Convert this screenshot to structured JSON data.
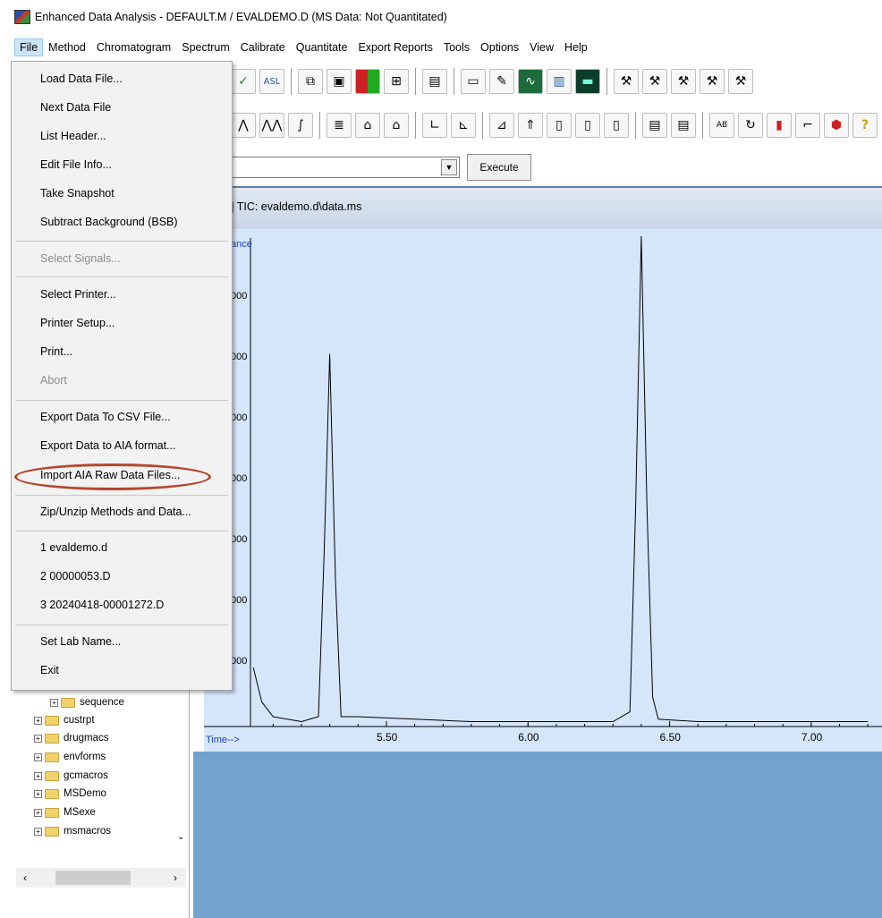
{
  "window": {
    "title": "Enhanced Data Analysis - DEFAULT.M / EVALDEMO.D    (MS Data: Not Quantitated)"
  },
  "menubar": {
    "items": [
      "File",
      "Method",
      "Chromatogram",
      "Spectrum",
      "Calibrate",
      "Quantitate",
      "Export Reports",
      "Tools",
      "Options",
      "View",
      "Help"
    ],
    "active": "File"
  },
  "file_menu": {
    "items": [
      {
        "label": "Load Data File...",
        "enabled": true
      },
      {
        "label": "Next Data File",
        "enabled": true
      },
      {
        "label": "List Header...",
        "enabled": true
      },
      {
        "label": "Edit File Info...",
        "enabled": true
      },
      {
        "label": "Take Snapshot",
        "enabled": true
      },
      {
        "label": "Subtract Background (BSB)",
        "enabled": true
      },
      {
        "label": "Select Signals...",
        "enabled": false
      },
      {
        "label": "Select Printer...",
        "enabled": true
      },
      {
        "label": "Printer Setup...",
        "enabled": true
      },
      {
        "label": "Print...",
        "enabled": true
      },
      {
        "label": "Abort",
        "enabled": false
      },
      {
        "label": "Export Data To CSV File...",
        "enabled": true
      },
      {
        "label": "Export Data to AIA format...",
        "enabled": true
      },
      {
        "label": "Import AIA Raw Data Files...",
        "enabled": true,
        "highlighted": true
      },
      {
        "label": "Zip/Unzip Methods and Data...",
        "enabled": true
      },
      {
        "label": "1  evaldemo.d",
        "enabled": true
      },
      {
        "label": "2  00000053.D",
        "enabled": true
      },
      {
        "label": "3  20240418-00001272.D",
        "enabled": true
      },
      {
        "label": "Set Lab Name...",
        "enabled": true
      },
      {
        "label": "Exit",
        "enabled": true
      }
    ],
    "highlight_color": "#b5482f"
  },
  "command": {
    "value": "",
    "execute_label": "Execute"
  },
  "chromatogram": {
    "title": "] TIC: evaldemo.d\\data.ms",
    "y_axis_partial_label": "ance",
    "x_axis_label": "Time-->",
    "x_ticks": [
      "5.50",
      "6.00",
      "6.50",
      "7.00"
    ],
    "y_tick_suffix": "000"
  },
  "chart_data": {
    "type": "line",
    "xlabel": "Time-->",
    "ylabel": "",
    "x_tick_labels": [
      "5.50",
      "6.00",
      "6.50",
      "7.00"
    ],
    "series": [
      {
        "x": [
          5.03,
          5.06,
          5.1,
          5.2,
          5.26,
          5.28,
          5.3,
          5.32,
          5.34,
          5.4,
          5.6,
          5.8,
          6.0,
          6.2,
          6.3,
          6.36,
          6.38,
          6.4,
          6.42,
          6.44,
          6.46,
          6.6,
          6.8,
          7.0,
          7.2
        ],
        "y": [
          0.12,
          0.05,
          0.02,
          0.01,
          0.02,
          0.35,
          0.76,
          0.3,
          0.02,
          0.02,
          0.015,
          0.01,
          0.01,
          0.01,
          0.01,
          0.03,
          0.45,
          1.0,
          0.45,
          0.06,
          0.015,
          0.01,
          0.01,
          0.01,
          0.01
        ]
      }
    ],
    "xlim": [
      5.02,
      7.25
    ],
    "ylim": [
      0,
      1.0
    ]
  },
  "tree": {
    "items": [
      {
        "label": "sequence",
        "level": 1
      },
      {
        "label": "custrpt",
        "level": 0
      },
      {
        "label": "drugmacs",
        "level": 0
      },
      {
        "label": "envforms",
        "level": 0
      },
      {
        "label": "gcmacros",
        "level": 0
      },
      {
        "label": "MSDemo",
        "level": 0
      },
      {
        "label": "MSexe",
        "level": 0
      },
      {
        "label": "msmacros",
        "level": 0
      }
    ]
  },
  "toolbar": {
    "row1_icons": [
      "check-icon",
      "asl-icon",
      "copy-icon",
      "save-icon",
      "color-icon",
      "tree-icon",
      "report-icon",
      "text-icon",
      "edit-icon",
      "graph-icon",
      "bars-icon",
      "monitor-icon",
      "hammer1-icon",
      "hammer2-icon",
      "hammer3-icon",
      "hammer4-icon",
      "hammer5-icon"
    ],
    "row2_icons": [
      "peak-icon",
      "peaks-icon",
      "integrate-icon",
      "library-icon",
      "building-icon",
      "building2-icon",
      "axis-icon",
      "axis2-icon",
      "chart1-icon",
      "chart2-icon",
      "doc1-icon",
      "doc2-icon",
      "doc3-icon",
      "doc4-icon",
      "doc5-icon",
      "ab-icon",
      "refresh-icon",
      "marker-icon",
      "flag-icon",
      "stop-icon",
      "help-icon"
    ]
  }
}
